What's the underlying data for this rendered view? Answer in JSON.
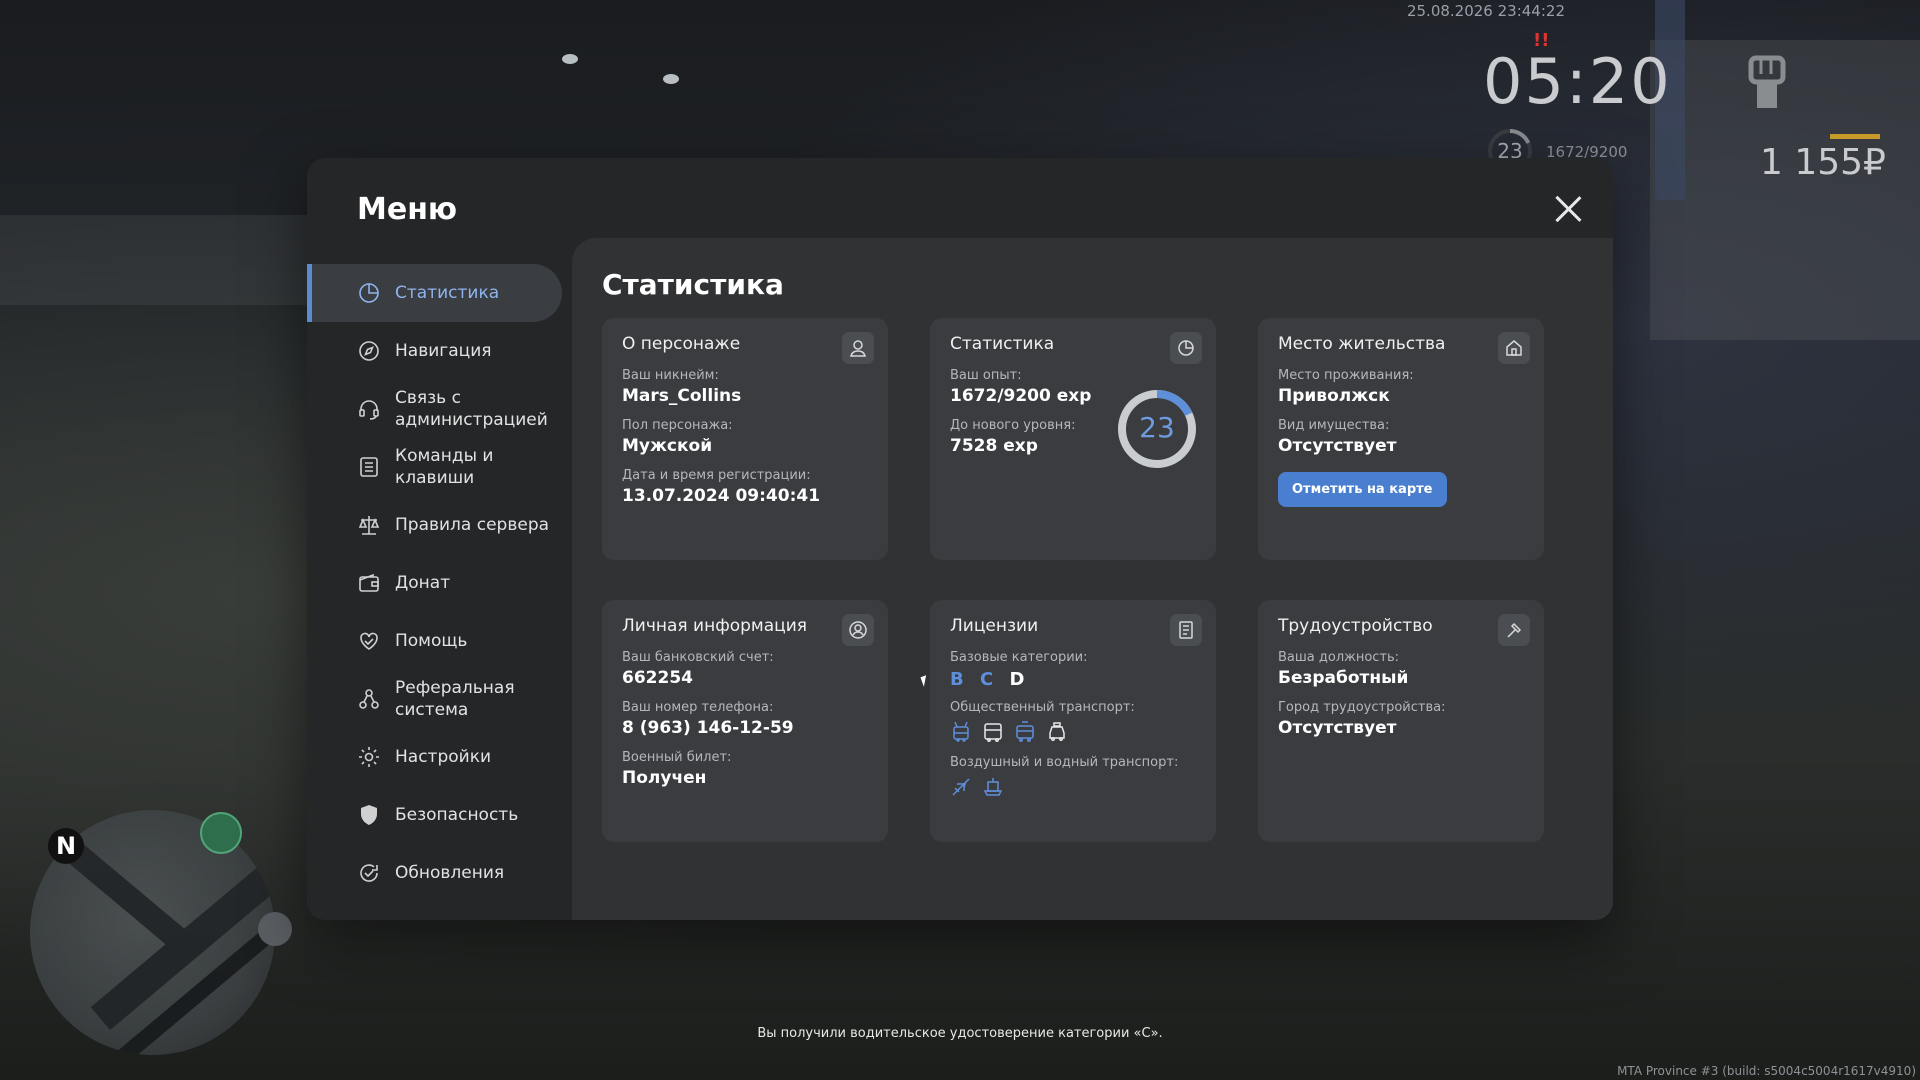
{
  "hud": {
    "datetime": "25.08.2026 23:44:22",
    "alert": "!!",
    "time": "05:20",
    "level": "23",
    "exp": "1672/9200",
    "money": "1 155₽",
    "fist_icon": "fist-icon"
  },
  "modal": {
    "title": "Меню",
    "close_icon": "close-icon"
  },
  "sidebar": {
    "items": [
      {
        "label": "Статистика",
        "icon": "pie-chart-icon",
        "active": true
      },
      {
        "label": "Навигация",
        "icon": "compass-icon"
      },
      {
        "label": "Связь с администрацией",
        "icon": "headset-icon"
      },
      {
        "label": "Команды и клавиши",
        "icon": "list-icon"
      },
      {
        "label": "Правила сервера",
        "icon": "scales-icon"
      },
      {
        "label": "Донат",
        "icon": "wallet-icon"
      },
      {
        "label": "Помощь",
        "icon": "heart-hand-icon"
      },
      {
        "label": "Реферальная система",
        "icon": "referral-icon"
      },
      {
        "label": "Настройки",
        "icon": "gear-icon"
      },
      {
        "label": "Безопасность",
        "icon": "shield-icon"
      },
      {
        "label": "Обновления",
        "icon": "refresh-icon"
      }
    ]
  },
  "content": {
    "title": "Статистика",
    "character": {
      "title": "О персонаже",
      "icon": "user-icon",
      "nickname_label": "Ваш никнейм:",
      "nickname": "Mars_Collins",
      "gender_label": "Пол персонажа:",
      "gender": "Мужской",
      "reg_label": "Дата и время регистрации:",
      "reg": "13.07.2024 09:40:41"
    },
    "stats": {
      "title": "Статистика",
      "icon": "pie-chart-icon",
      "exp_label": "Ваш опыт:",
      "exp": "1672/9200 exp",
      "next_label": "До нового уровня:",
      "next": "7528 exp",
      "level": "23",
      "progress": 0.18
    },
    "residence": {
      "title": "Место жительства",
      "icon": "house-icon",
      "place_label": "Место проживания:",
      "place": "Приволжск",
      "property_label": "Вид имущества:",
      "property": "Отсутствует",
      "button": "Отметить на карте"
    },
    "personal": {
      "title": "Личная информация",
      "icon": "user-circle-icon",
      "bank_label": "Ваш банковский счет:",
      "bank": "662254",
      "phone_label": "Ваш номер телефона:",
      "phone": "8 (963) 146-12-59",
      "military_label": "Военный билет:",
      "military": "Получен"
    },
    "licenses": {
      "title": "Лицензии",
      "icon": "document-icon",
      "base_label": "Базовые категории:",
      "cat_b": "B",
      "cat_c": "C",
      "cat_d": "D",
      "public_label": "Общественный транспорт:",
      "public_icons": [
        "trolleybus-icon",
        "bus-icon",
        "tram-icon",
        "taxi-icon"
      ],
      "air_label": "Воздушный и водный транспорт:",
      "air_icons": [
        "plane-icon",
        "boat-icon"
      ]
    },
    "job": {
      "title": "Трудоустройство",
      "icon": "hammer-icon",
      "position_label": "Ваша должность:",
      "position": "Безработный",
      "city_label": "Город трудоустройства:",
      "city": "Отсутствует"
    }
  },
  "minimap": {
    "north": "N"
  },
  "notice": "Вы получили водительское удостоверение категории «С».",
  "build": "MTA Province #3 (build: s5004c5004r1617v4910)",
  "colors": {
    "accent": "#5e8fdb",
    "panel": "#242628",
    "card": "#3a3c3f"
  }
}
